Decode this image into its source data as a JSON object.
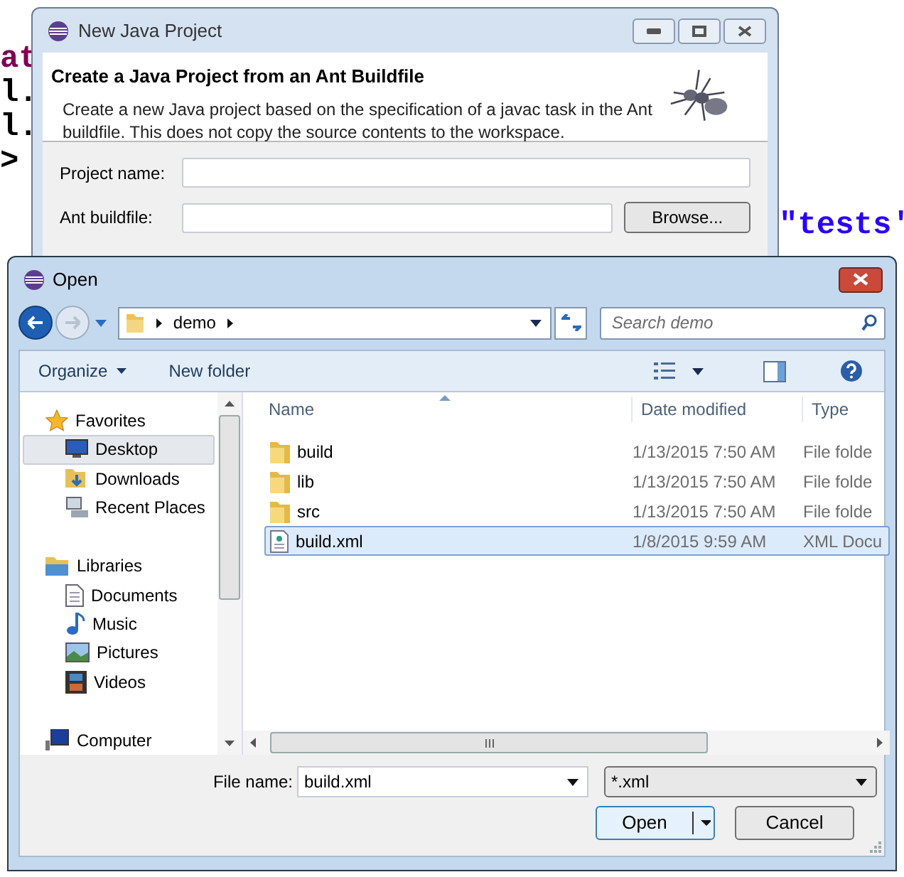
{
  "background_code": {
    "left_lines": [
      "at",
      "l.",
      "l.",
      ">"
    ],
    "right_text": "\"tests'"
  },
  "project_dialog": {
    "title": "New Java Project",
    "heading": "Create a Java Project from an Ant Buildfile",
    "description": "Create a new Java project based on the specification of a javac task in the Ant buildfile. This does not copy the source contents to the workspace.",
    "fields": [
      {
        "label": "Project name:"
      },
      {
        "label": "Ant buildfile:"
      }
    ],
    "browse_button": "Browse..."
  },
  "open_dialog": {
    "title": "Open",
    "breadcrumb": [
      "demo"
    ],
    "search": {
      "placeholder": "Search demo"
    },
    "organize": "Organize",
    "new_folder": "New folder",
    "nav": [
      {
        "label": "Favorites",
        "children": [
          {
            "label": "Desktop",
            "selected": true
          },
          {
            "label": "Downloads",
            "selected": false
          },
          {
            "label": "Recent Places",
            "selected": false
          }
        ]
      },
      {
        "label": "Libraries",
        "children": [
          {
            "label": "Documents",
            "selected": false
          },
          {
            "label": "Music",
            "selected": false
          },
          {
            "label": "Pictures",
            "selected": false
          },
          {
            "label": "Videos",
            "selected": false
          }
        ]
      },
      {
        "label": "Computer"
      }
    ],
    "columns": [
      "Name",
      "Date modified",
      "Type"
    ],
    "files": [
      {
        "name": "build",
        "date": "1/13/2015 7:50 AM",
        "type": "File folde",
        "kind": "folder",
        "selected": false
      },
      {
        "name": "lib",
        "date": "1/13/2015 7:50 AM",
        "type": "File folde",
        "kind": "folder",
        "selected": false
      },
      {
        "name": "src",
        "date": "1/13/2015 7:50 AM",
        "type": "File folde",
        "kind": "folder",
        "selected": false
      },
      {
        "name": "build.xml",
        "date": "1/8/2015 9:59 AM",
        "type": "XML Docu",
        "kind": "file",
        "selected": true
      }
    ],
    "file_name": {
      "label": "File name:",
      "value": "build.xml"
    },
    "filter": "*.xml",
    "buttons": [
      "Open",
      "Cancel"
    ]
  }
}
